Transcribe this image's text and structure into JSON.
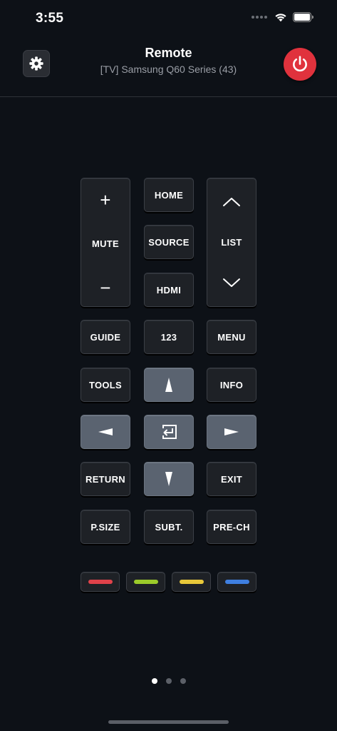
{
  "status_bar": {
    "time": "3:55"
  },
  "header": {
    "title": "Remote",
    "subtitle": "[TV] Samsung Q60 Series (43)",
    "settings_icon": "gear-icon",
    "power_icon": "power-icon",
    "power_color": "#e0323d"
  },
  "remote": {
    "volume": {
      "plus": "+",
      "label": "MUTE",
      "minus": "−"
    },
    "home": "HOME",
    "source": "SOURCE",
    "hdmi": "HDMI",
    "list": "LIST",
    "guide": "GUIDE",
    "numpad": "123",
    "menu": "MENU",
    "tools": "TOOLS",
    "info": "INFO",
    "return": "RETURN",
    "exit": "EXIT",
    "psize": "P.SIZE",
    "subt": "SUBT.",
    "prech": "PRE-CH",
    "color_keys": [
      {
        "name": "red",
        "color": "#e0424a"
      },
      {
        "name": "green",
        "color": "#9ccb2a"
      },
      {
        "name": "yellow",
        "color": "#e8c83a"
      },
      {
        "name": "blue",
        "color": "#3f7fe0"
      }
    ]
  },
  "pager": {
    "pages": 3,
    "active": 1
  }
}
